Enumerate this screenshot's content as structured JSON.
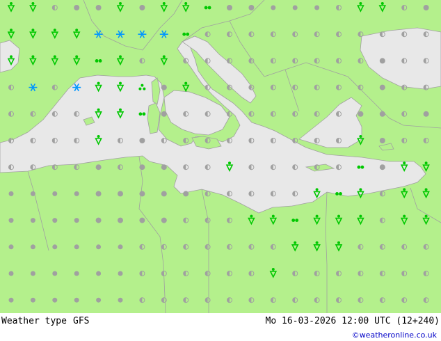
{
  "title": "Weather type",
  "model": "GFS",
  "valid_time": "Mo 16-03-2026 12:00 UTC (12+240)",
  "credit": "©weatheronline.co.uk",
  "colors": {
    "land": "#b4f08c",
    "sea": "#e8e8e8",
    "border": "#a0a0a0",
    "coast": "#a0a0a0",
    "dot_dry": "#a0a0a0",
    "precip_rain": "#00c800",
    "precip_snow": "#0096ff"
  },
  "legend_note": "grey dot = dry; half-filled dot = cloudy; green = rain/showers; blue = snow",
  "grid": {
    "cols": 20,
    "rows": 12
  },
  "symbols": [
    [
      "shower",
      "shower",
      "half",
      "cloud",
      "cloud",
      "shower",
      "cloud",
      "shower",
      "shower",
      "showers2",
      "cloud",
      "cloud",
      "dot",
      "dot",
      "dot",
      "half",
      "shower",
      "shower",
      "half",
      "cloud"
    ],
    [
      "rain",
      "rain",
      "rain",
      "rain",
      "snow_blue",
      "snow_blue2",
      "snow_blue2",
      "snow_blue2",
      "showers2",
      "half",
      "half",
      "half",
      "half",
      "half",
      "half",
      "half",
      "half",
      "half",
      "half",
      "half"
    ],
    [
      "rain",
      "rain",
      "rain",
      "rain",
      "showers2",
      "shower",
      "half",
      "shower",
      "half",
      "half",
      "half",
      "half",
      "half",
      "half",
      "half",
      "half",
      "half",
      "cloud",
      "half",
      "half"
    ],
    [
      "half",
      "snow_blue",
      "half",
      "snow_blue",
      "shower",
      "shower",
      "showers_small",
      "cloud",
      "shower",
      "half",
      "half",
      "half",
      "half",
      "half",
      "half",
      "half",
      "half",
      "cloud",
      "half",
      "half"
    ],
    [
      "half",
      "half",
      "half",
      "half",
      "rain",
      "rain",
      "showers2",
      "cloud",
      "half",
      "half",
      "half",
      "half",
      "half",
      "half",
      "half",
      "half",
      "cloud",
      "cloud",
      "half",
      "cloud"
    ],
    [
      "half",
      "half",
      "half",
      "half",
      "rain",
      "half",
      "cloud",
      "half",
      "half",
      "half",
      "half",
      "half",
      "half",
      "half",
      "half",
      "half",
      "rain",
      "cloud",
      "half",
      "half"
    ],
    [
      "half",
      "half",
      "half",
      "half",
      "cloud",
      "half",
      "cloud",
      "cloud",
      "half",
      "half",
      "rain",
      "half",
      "half",
      "half",
      "half",
      "half",
      "showers2",
      "cloud",
      "rain",
      "rain"
    ],
    [
      "dot",
      "dot",
      "dot",
      "dot",
      "cloud",
      "cloud",
      "cloud",
      "cloud",
      "cloud",
      "half",
      "half",
      "half",
      "half",
      "half",
      "rain",
      "showers2",
      "shower",
      "half",
      "rain",
      "rain"
    ],
    [
      "dot",
      "dot",
      "dot",
      "dot",
      "cloud",
      "cloud",
      "cloud",
      "cloud",
      "half",
      "half",
      "half",
      "rain",
      "rain",
      "showers2",
      "rain",
      "rain",
      "rain",
      "half",
      "shower",
      "shower"
    ],
    [
      "dot",
      "dot",
      "dot",
      "dot",
      "dot",
      "dot",
      "half",
      "half",
      "half",
      "half",
      "half",
      "half",
      "half",
      "rain",
      "rain",
      "rain",
      "half",
      "half",
      "half",
      "half"
    ],
    [
      "dot",
      "dot",
      "dot",
      "dot",
      "dot",
      "dot",
      "half",
      "half",
      "half",
      "half",
      "half",
      "half",
      "rain",
      "half",
      "half",
      "half",
      "half",
      "half",
      "half",
      "half"
    ],
    [
      "dot",
      "dot",
      "dot",
      "dot",
      "dot",
      "dot",
      "half",
      "half",
      "half",
      "half",
      "half",
      "half",
      "half",
      "half",
      "half",
      "half",
      "half",
      "half",
      "half",
      "half"
    ]
  ]
}
